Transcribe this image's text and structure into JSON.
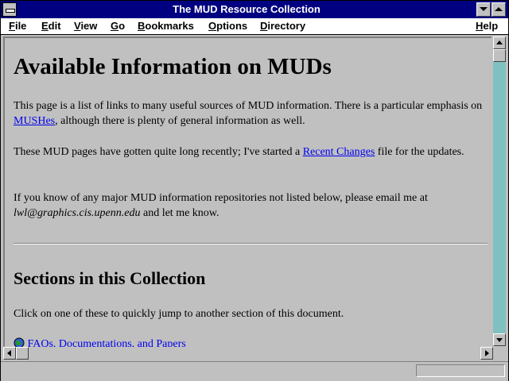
{
  "window": {
    "title": "The MUD Resource Collection"
  },
  "menubar": {
    "items": [
      {
        "first": "F",
        "rest": "ile"
      },
      {
        "first": "E",
        "rest": "dit"
      },
      {
        "first": "V",
        "rest": "iew"
      },
      {
        "first": "G",
        "rest": "o"
      },
      {
        "first": "B",
        "rest": "ookmarks"
      },
      {
        "first": "O",
        "rest": "ptions"
      },
      {
        "first": "D",
        "rest": "irectory"
      },
      {
        "first": "H",
        "rest": "elp"
      }
    ]
  },
  "page": {
    "heading": "Available Information on MUDs",
    "intro": {
      "text1": "This page is a list of links to many useful sources of MUD information. There is a particular emphasis on ",
      "link": "MUSHes",
      "text2": ", although there is plenty of general information as well."
    },
    "changes": {
      "text1": "These MUD pages have gotten quite long recently; I've started a ",
      "link": "Recent Changes",
      "text2": " file for the updates."
    },
    "contact": {
      "text1": "If you know of any major MUD information repositories not listed below, please email me at ",
      "email": "lwl@graphics.cis.upenn.edu",
      "text2": " and let me know."
    },
    "sections_heading": "Sections in this Collection",
    "sections_intro": "Click on one of these to quickly jump to another section of this document.",
    "first_section_link": "FAQs, Documentations, and Papers"
  },
  "status": {
    "text": ""
  },
  "colors": {
    "titlebar": "#000080",
    "link": "#0000ee",
    "background": "#c0c0c0",
    "scroll_track": "#80c0c0"
  },
  "icons": [
    "system-menu-icon",
    "minimize-icon",
    "maximize-icon",
    "scroll-up-icon",
    "scroll-down-icon",
    "scroll-left-icon",
    "scroll-right-icon",
    "globe-icon"
  ]
}
